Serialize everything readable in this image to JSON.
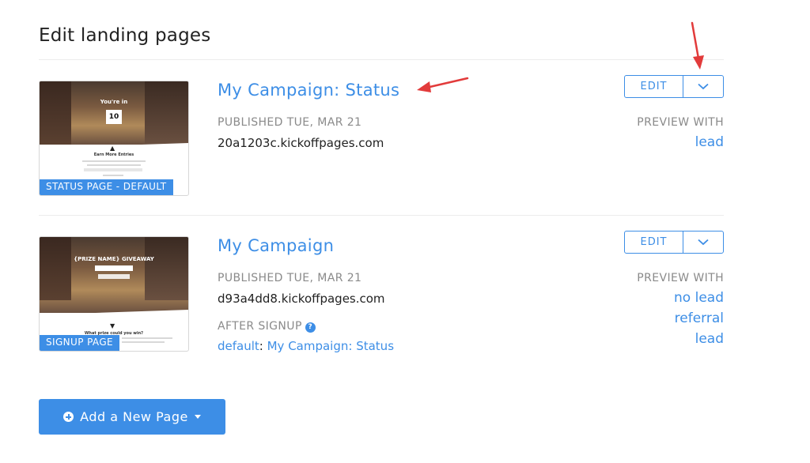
{
  "page": {
    "title": "Edit landing pages"
  },
  "pages": [
    {
      "thumbnail": {
        "label": "STATUS PAGE - DEFAULT",
        "hero_text": "You're in",
        "count": "10",
        "section_heading": "Earn More Entries"
      },
      "title": "My Campaign: Status",
      "published": "PUBLISHED TUE, MAR 21",
      "domain": "20a1203c.kickoffpages.com",
      "edit_label": "EDIT",
      "preview_label": "PREVIEW WITH",
      "preview_links": [
        "lead"
      ]
    },
    {
      "thumbnail": {
        "label": "SIGNUP PAGE",
        "hero_text": "{PRIZE NAME} GIVEAWAY",
        "section_heading": "What prize could you win?"
      },
      "title": "My Campaign",
      "published": "PUBLISHED TUE, MAR 21",
      "domain": "d93a4dd8.kickoffpages.com",
      "after_signup_label": "AFTER SIGNUP",
      "after_signup_key": "default",
      "after_signup_sep": ": ",
      "after_signup_value": "My Campaign: Status",
      "edit_label": "EDIT",
      "preview_label": "PREVIEW WITH",
      "preview_links": [
        "no lead",
        "referral",
        "lead"
      ]
    }
  ],
  "add_button": {
    "label": "Add a New Page"
  },
  "colors": {
    "accent": "#3d8ee6",
    "annotation_arrow": "#e23b3b",
    "muted": "#8a8a8a"
  },
  "icons": {
    "help": "question-circle-icon",
    "dropdown": "chevron-down-icon",
    "add": "plus-circle-icon",
    "caret": "caret-down-icon"
  }
}
